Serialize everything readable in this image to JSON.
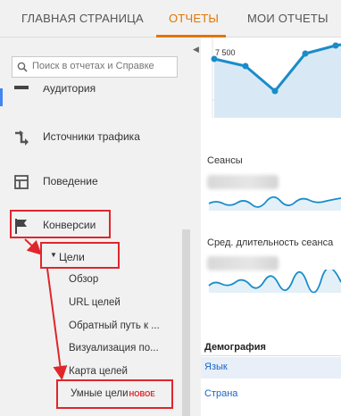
{
  "topnav": {
    "tabs": [
      "ГЛАВНАЯ СТРАНИЦА",
      "ОТЧЕТЫ",
      "МОИ ОТЧЕТЫ"
    ],
    "active_tab": "ОТЧЕТЫ",
    "accent": "#e37400"
  },
  "sidebar": {
    "search_placeholder": "Поиск в отчетах и Справке",
    "items": [
      {
        "label": "Аудитория",
        "icon": "audience-icon"
      },
      {
        "label": "Источники трафика",
        "icon": "traffic-sources-icon"
      },
      {
        "label": "Поведение",
        "icon": "behavior-icon"
      },
      {
        "label": "Конверсии",
        "icon": "flag-icon"
      }
    ],
    "goals": {
      "label": "Цели",
      "children": [
        "Обзор",
        "URL целей",
        "Обратный путь к ...",
        "Визуализация по...",
        "Карта целей",
        "Умные цели"
      ],
      "new_badge": "НОВОЕ"
    }
  },
  "main": {
    "chart_tick": "7 500",
    "metrics": [
      {
        "label": "Сеансы"
      },
      {
        "label": "Сред. длительность сеанса"
      }
    ],
    "demographics": {
      "title": "Демография",
      "rows": [
        "Язык",
        "Страна"
      ]
    }
  },
  "colors": {
    "annotation": "#e0262b",
    "line": "#1a8cc9",
    "link": "#1a67c6"
  }
}
